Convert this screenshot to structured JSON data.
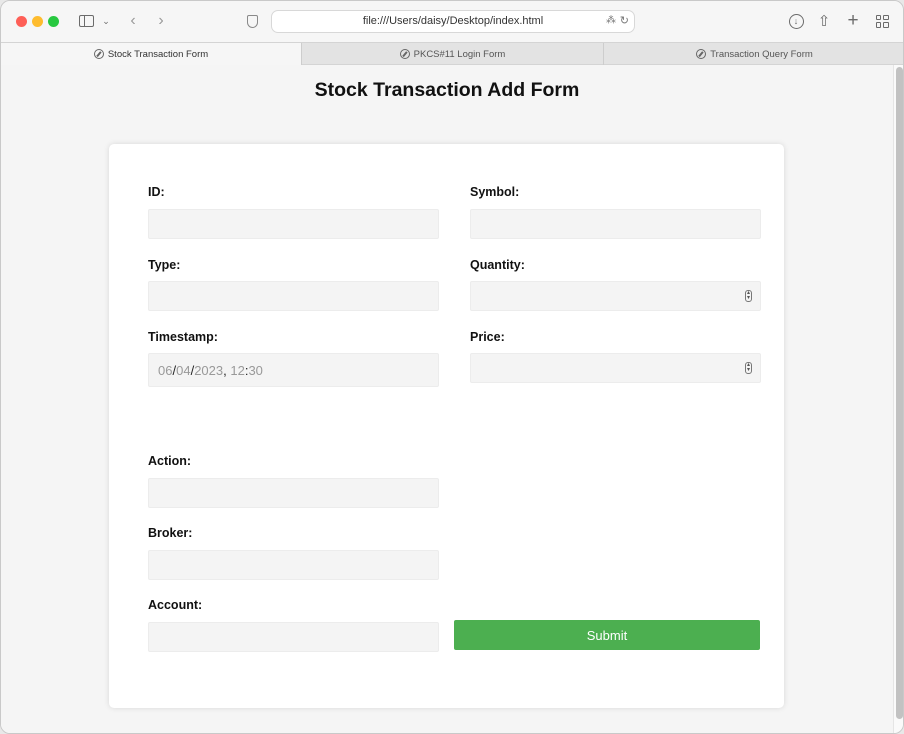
{
  "browser": {
    "url": "file:///Users/daisy/Desktop/index.html",
    "tabs": [
      {
        "label": "Stock Transaction Form",
        "active": true
      },
      {
        "label": "PKCS#11 Login Form",
        "active": false
      },
      {
        "label": "Transaction Query Form",
        "active": false
      }
    ]
  },
  "form": {
    "title": "Stock Transaction Add Form",
    "fields": {
      "id": {
        "label": "ID:",
        "value": ""
      },
      "symbol": {
        "label": "Symbol:",
        "value": ""
      },
      "type": {
        "label": "Type:",
        "value": ""
      },
      "quantity": {
        "label": "Quantity:",
        "value": ""
      },
      "timestamp": {
        "label": "Timestamp:",
        "month": "06",
        "day": "04",
        "year": "2023",
        "hour": "12",
        "minute": "30"
      },
      "price": {
        "label": "Price:",
        "value": ""
      },
      "action": {
        "label": "Action:",
        "value": ""
      },
      "broker": {
        "label": "Broker:",
        "value": ""
      },
      "account": {
        "label": "Account:",
        "value": ""
      }
    },
    "submit_label": "Submit"
  },
  "colors": {
    "submit_bg": "#4caf50",
    "traffic_red": "#fe5f57",
    "traffic_yellow": "#febc2e",
    "traffic_green": "#28c840"
  },
  "icons": [
    "sidebar-icon",
    "chevron-down-icon",
    "back-icon",
    "forward-icon",
    "shield-icon",
    "translate-icon",
    "reload-icon",
    "download-icon",
    "share-icon",
    "new-tab-icon",
    "tab-overview-icon",
    "compass-icon"
  ]
}
